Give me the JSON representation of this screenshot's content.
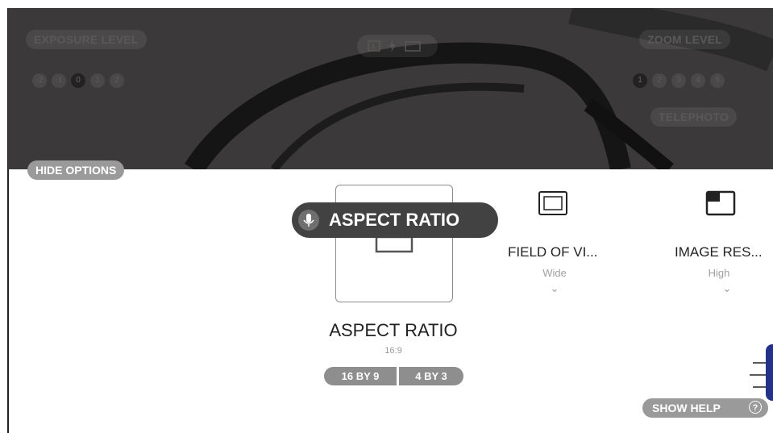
{
  "camera": {
    "exposure_label": "EXPOSURE LEVEL",
    "exposure_values": [
      "-2",
      "-1",
      "0",
      "1",
      "2"
    ],
    "exposure_selected": "0",
    "zoom_label": "ZOOM LEVEL",
    "zoom_values": [
      "1",
      "2",
      "3",
      "4",
      "5"
    ],
    "zoom_selected": "1",
    "telephoto_label": "TELEPHOTO",
    "hide_options_label": "HIDE OPTIONS"
  },
  "voice_tooltip": {
    "label": "ASPECT RATIO"
  },
  "options": {
    "aspect": {
      "title": "ASPECT RATIO",
      "value": "16:9",
      "choices": [
        "16 BY 9",
        "4 BY 3"
      ]
    },
    "fov": {
      "title": "FIELD OF VI...",
      "value": "Wide"
    },
    "resolution": {
      "title": "IMAGE RES...",
      "value": "High"
    }
  },
  "help": {
    "label": "SHOW HELP",
    "icon": "?"
  },
  "colors": {
    "help_tab": "#23318a",
    "tooltip_bg": "#424242",
    "pill_bg": "#9a9a9a"
  }
}
